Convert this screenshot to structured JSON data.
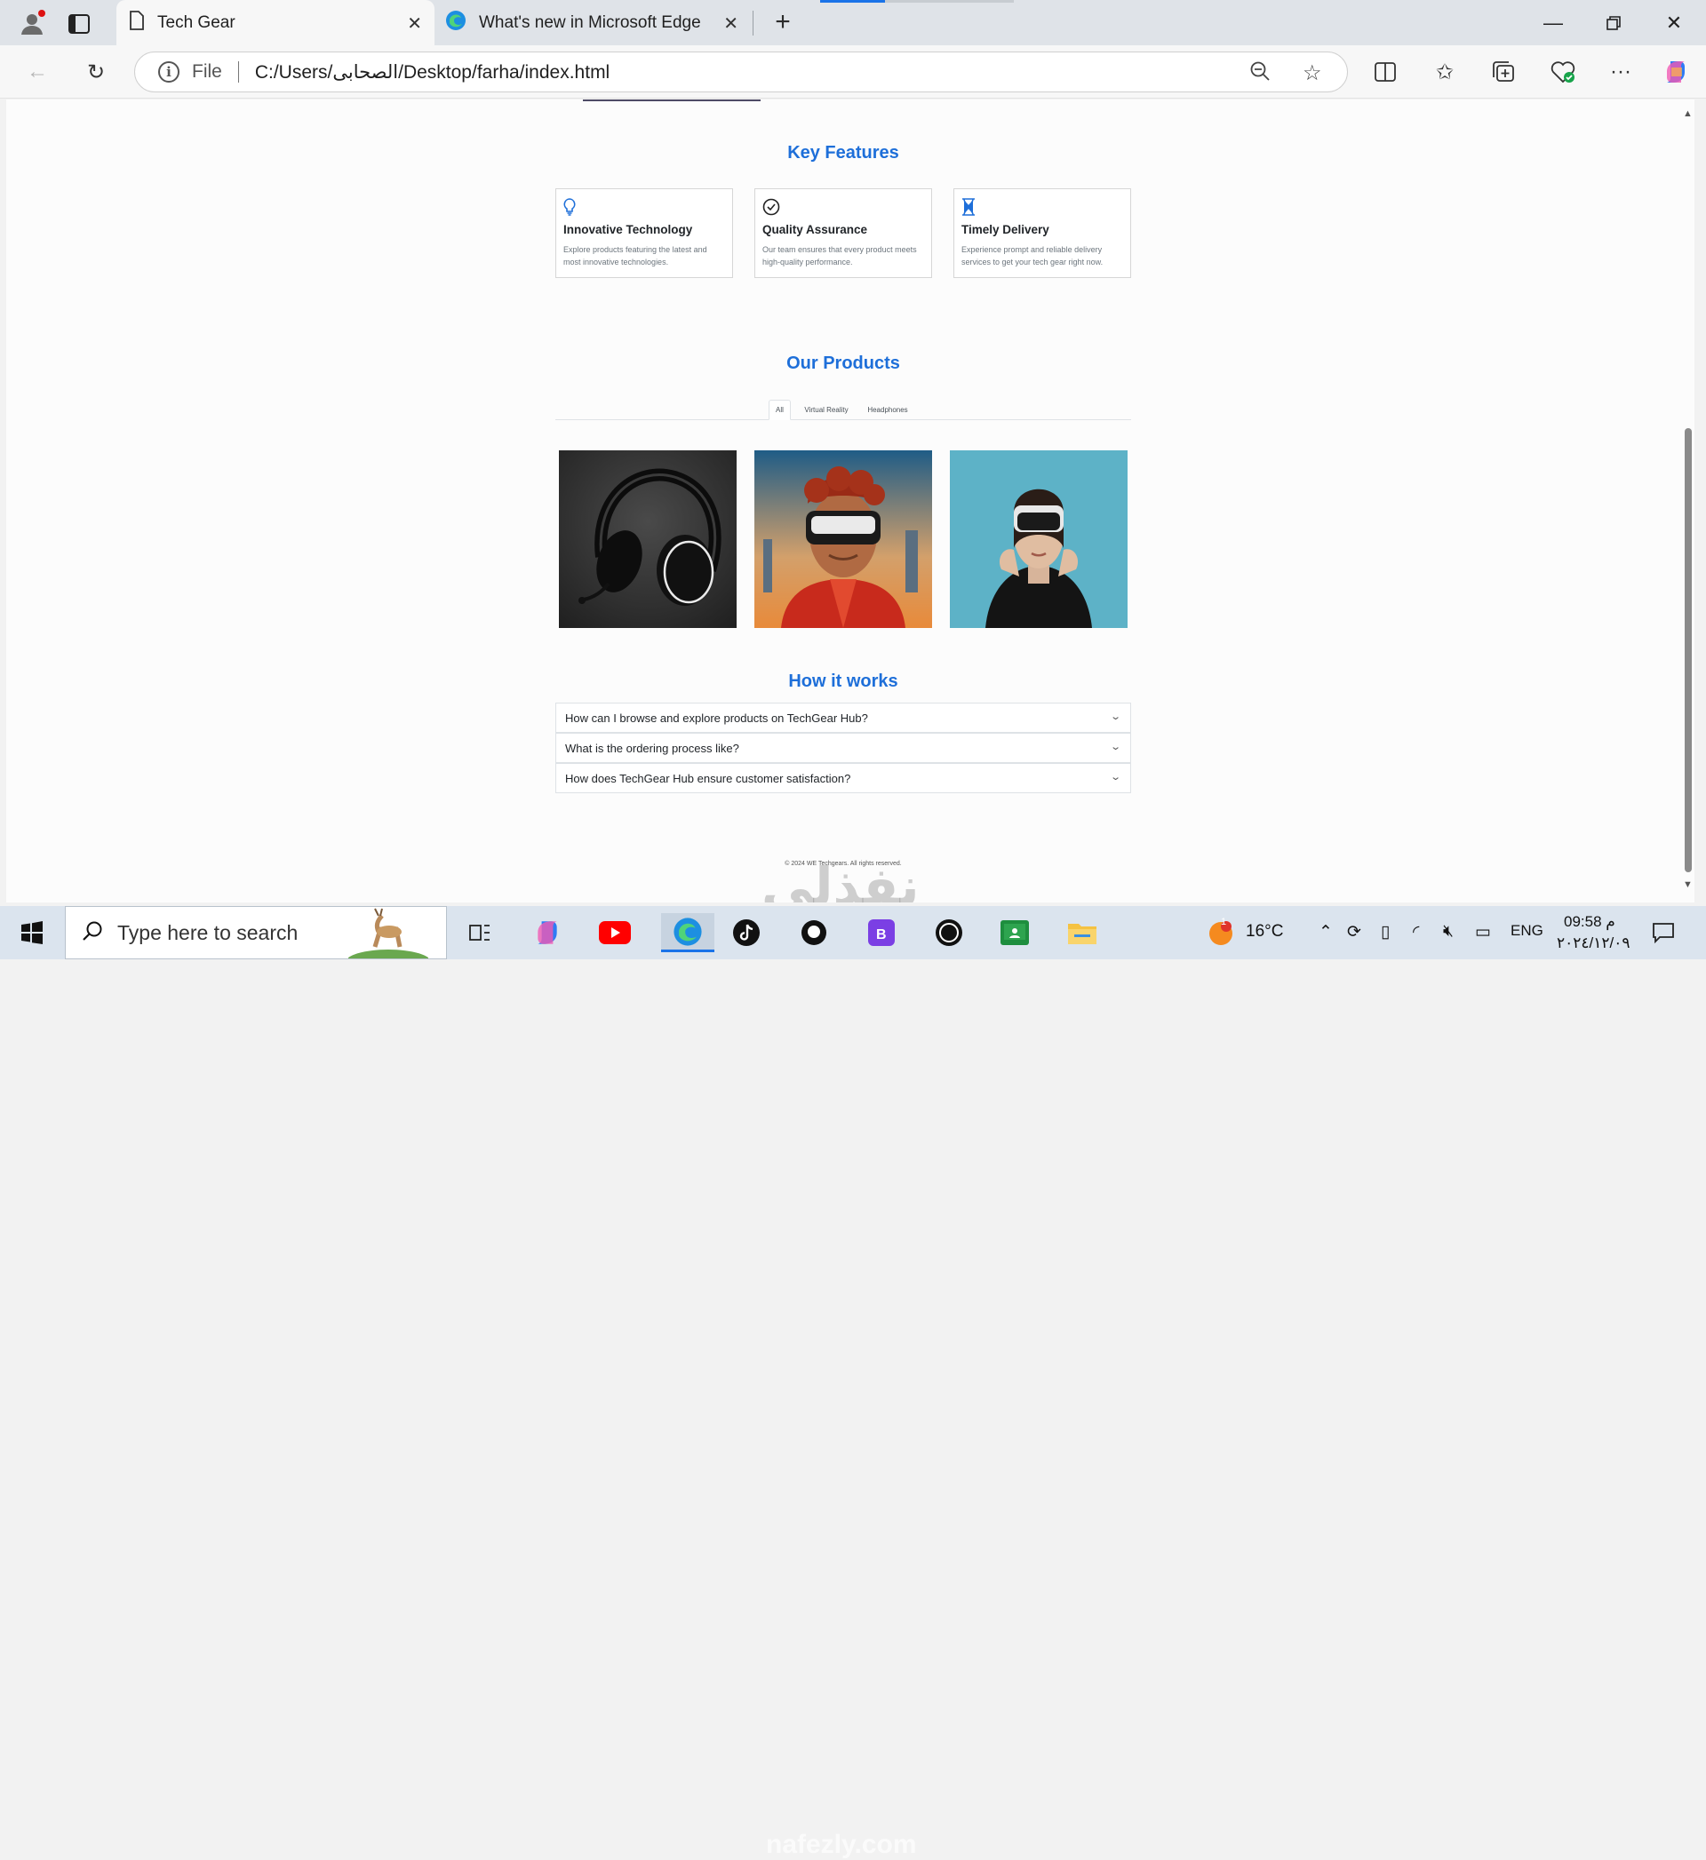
{
  "browser": {
    "tabs": [
      {
        "title": "Tech Gear",
        "active": true,
        "icon": "page-icon"
      },
      {
        "title": "What's new in Microsoft Edge",
        "active": false,
        "icon": "edge-icon"
      }
    ],
    "address": {
      "scheme": "File",
      "url": "C:/Users/الصحابى/Desktop/farha/index.html"
    }
  },
  "page": {
    "features_title": "Key Features",
    "features": [
      {
        "icon": "lightbulb-icon",
        "title": "Innovative Technology",
        "text": "Explore products featuring the latest and most innovative technologies."
      },
      {
        "icon": "check-circle-icon",
        "title": "Quality Assurance",
        "text": "Our team ensures that every product meets high-quality performance."
      },
      {
        "icon": "hourglass-icon",
        "title": "Timely Delivery",
        "text": "Experience prompt and reliable delivery services to get your tech gear right now."
      }
    ],
    "products_title": "Our Products",
    "product_tabs": [
      "All",
      "Virtual Reality",
      "Headphones"
    ],
    "active_tab": "All",
    "products": [
      "headphones-image",
      "vr-man-image",
      "vr-woman-image"
    ],
    "how_title": "How it works",
    "faqs": [
      "How can I browse and explore products on TechGear Hub?",
      "What is the ordering process like?",
      "How does TechGear Hub ensure customer satisfaction?"
    ],
    "footer": "© 2024 WE Techgears. All rights reserved."
  },
  "watermark": {
    "arabic": "نفذلي",
    "latin": "nafezly.com"
  },
  "taskbar": {
    "search_placeholder": "Type here to search",
    "weather": "16°C",
    "weather_badge": "1",
    "lang": "ENG",
    "time": "09:58 م",
    "date": "٢٠٢٤/١٢/٠٩"
  }
}
